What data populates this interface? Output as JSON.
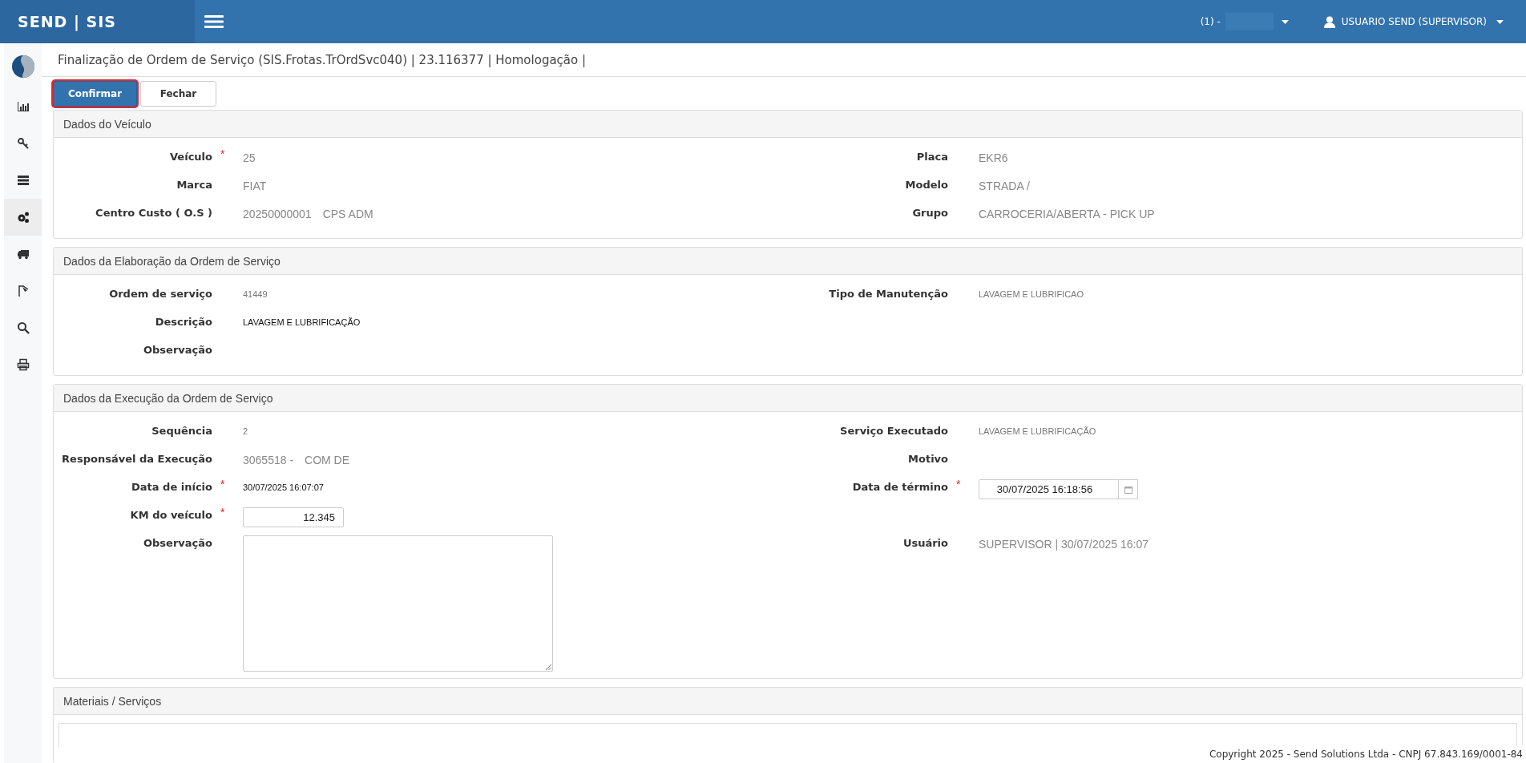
{
  "topbar": {
    "brand": "SEND | SIS",
    "company": "(1) -",
    "user": "USUARIO SEND (SUPERVISOR)"
  },
  "sidebar": {
    "items": [
      {
        "selected": false
      },
      {
        "selected": false
      },
      {
        "selected": false
      },
      {
        "selected": true
      },
      {
        "selected": false
      },
      {
        "selected": false
      },
      {
        "selected": false
      },
      {
        "selected": false
      }
    ]
  },
  "page_title": "Finalização de Ordem de Serviço (SIS.Frotas.TrOrdSvc040) | 23.116377 | Homologação |",
  "buttons": [
    {
      "label": "Confirmar",
      "primary": true,
      "focused": true
    },
    {
      "label": "Fechar",
      "primary": false,
      "focused": false
    }
  ],
  "sections": [
    {
      "title": "Dados do Veículo",
      "rows": [
        {
          "left": {
            "label": "Veículo",
            "required_mark": "*",
            "kind": "text",
            "values": [
              "25"
            ]
          },
          "right": {
            "label": "Placa",
            "kind": "text",
            "values": [
              "EKR6"
            ]
          }
        },
        {
          "left": {
            "label": "Marca",
            "kind": "text",
            "values": [
              "FIAT"
            ]
          },
          "right": {
            "label": "Modelo",
            "kind": "text",
            "values": [
              "STRADA /"
            ]
          }
        },
        {
          "left": {
            "label": "Centro Custo ( O.S )",
            "kind": "text",
            "values": [
              "20250000001",
              "CPS ADM"
            ]
          },
          "right": {
            "label": "Grupo",
            "kind": "text",
            "values": [
              "CARROCERIA/ABERTA - PICK UP"
            ]
          }
        }
      ]
    },
    {
      "title": "Dados da Elaboração da Ordem de Serviço",
      "rows": [
        {
          "left": {
            "label": "Ordem de serviço",
            "kind": "small",
            "values": [
              "41449"
            ]
          },
          "right": {
            "label": "Tipo de Manutenção",
            "kind": "small",
            "values": [
              "LAVAGEM E LUBRIFICAO"
            ]
          }
        },
        {
          "left": {
            "label": "Descrição",
            "kind": "dark",
            "values": [
              "LAVAGEM E LUBRIFICAÇÃO"
            ]
          }
        },
        {
          "left": {
            "label": "Observação",
            "kind": "text"
          }
        }
      ]
    },
    {
      "title": "Dados da Execução da Ordem de Serviço",
      "rows": [
        {
          "left": {
            "label": "Sequência",
            "kind": "small",
            "values": [
              "2"
            ]
          },
          "right": {
            "label": "Serviço Executado",
            "kind": "small",
            "values": [
              "LAVAGEM E LUBRIFICAÇÃO"
            ]
          }
        },
        {
          "left": {
            "label": "Responsável da Execução",
            "kind": "text",
            "values": [
              "3065518 -",
              "COM DE"
            ]
          },
          "right": {
            "label": "Motivo",
            "kind": "text"
          }
        },
        {
          "left": {
            "label": "Data de início",
            "required_mark": "*",
            "kind": "dark",
            "values": [
              "30/07/2025 16:07:07"
            ]
          },
          "right": {
            "label": "Data de término",
            "required_mark": "*",
            "kind": "date",
            "values": [
              "30/07/2025 16:18:56"
            ]
          }
        },
        {
          "left": {
            "label": "KM do veículo",
            "required_mark": "*",
            "kind": "input",
            "values": [
              "12.345"
            ]
          }
        },
        {
          "left": {
            "label": "Observação",
            "kind": "textarea"
          },
          "right": {
            "label": "Usuário",
            "kind": "text",
            "values": [
              "SUPERVISOR | 30/07/2025 16:07"
            ]
          }
        }
      ]
    },
    {
      "title": "Materiais / Serviços"
    }
  ],
  "footer": "Copyright 2025 - Send Solutions Ltda - CNPJ 67.843.169/0001-84"
}
